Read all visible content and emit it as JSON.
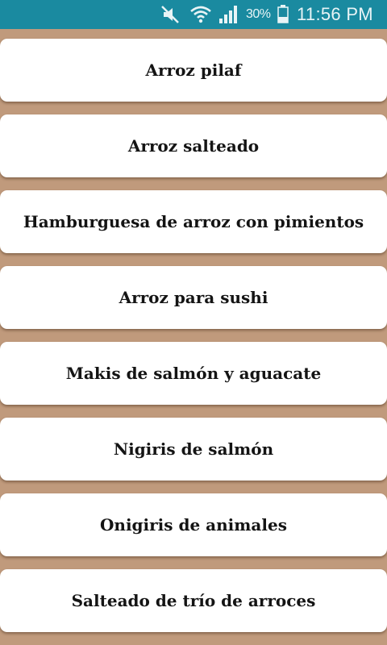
{
  "status_bar": {
    "battery_percent": "30%",
    "time": "11:56 PM",
    "icons": [
      "mute-icon",
      "wifi-icon",
      "signal-icon",
      "battery-icon"
    ],
    "background": "#1a8aa0"
  },
  "recipes": [
    {
      "label": "Arroz pilaf"
    },
    {
      "label": "Arroz salteado"
    },
    {
      "label": "Hamburguesa de arroz con pimientos"
    },
    {
      "label": "Arroz para sushi"
    },
    {
      "label": "Makis de salmón y aguacate"
    },
    {
      "label": "Nigiris de salmón"
    },
    {
      "label": "Onigiris de animales"
    },
    {
      "label": "Salteado de trío de arroces"
    }
  ],
  "colors": {
    "page_background": "#c09a7c",
    "card_background": "#ffffff",
    "text": "#141414"
  }
}
